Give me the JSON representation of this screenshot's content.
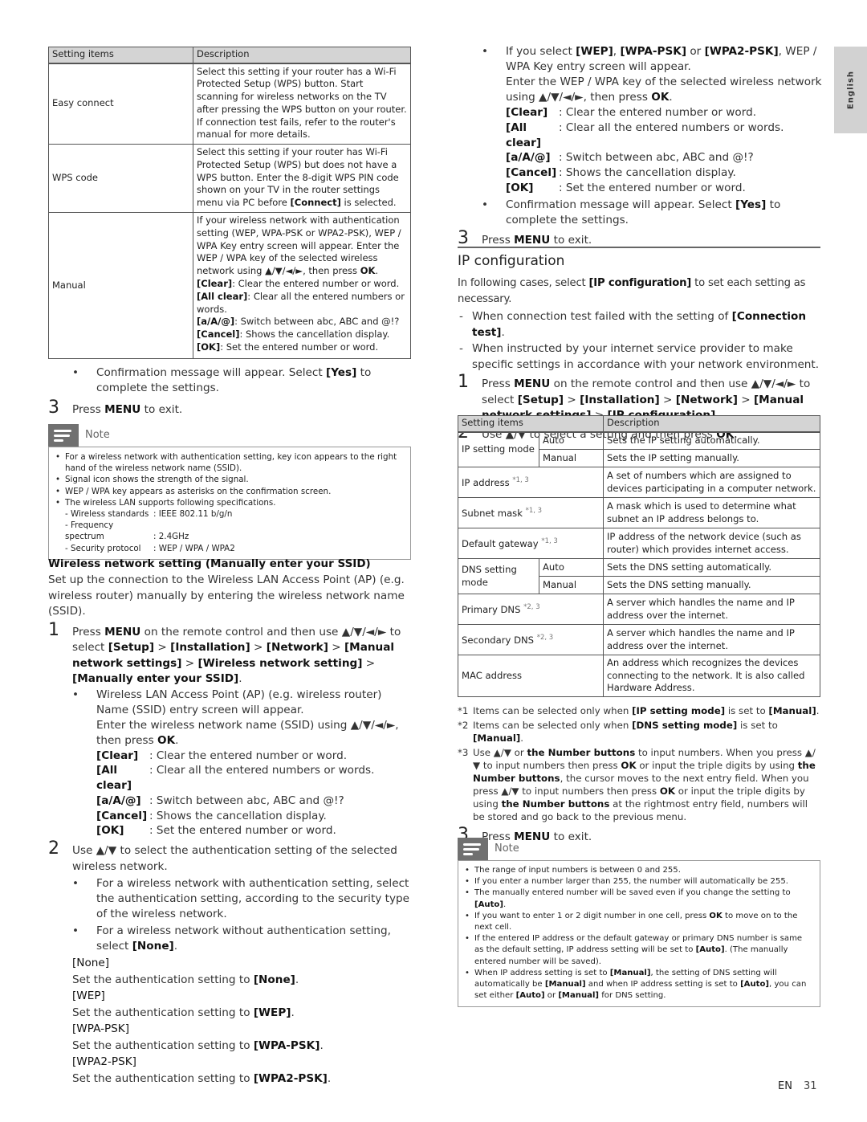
{
  "side_tab": {
    "label": "English"
  },
  "left": {
    "table": {
      "headers": [
        "Setting items",
        "Description"
      ],
      "rows": [
        {
          "item": "Easy connect",
          "desc": "Select this setting if your router has a Wi-Fi Protected Setup (WPS) button. Start scanning for wireless networks on the TV after pressing the WPS button on your router. If connection test fails, refer to the router's manual for more details."
        },
        {
          "item": "WPS code",
          "desc_pre": "Select this setting if your router has Wi-Fi Protected Setup (WPS) but does not have a WPS button. Enter the 8-digit WPS PIN code shown on your TV in the router settings menu via PC before ",
          "desc_bold": "[Connect]",
          "desc_post": " is selected."
        },
        {
          "item": "Manual",
          "desc_intro": "If your wireless network with authentication setting (WEP, WPA-PSK or WPA2-PSK), WEP / WPA Key entry screen will appear. Enter the WEP / WPA key of the selected wireless network using ▲/▼/◄/►, then press ",
          "desc_intro_bold": "OK",
          "keys": [
            {
              "k": "[Clear]",
              "v": ": Clear the entered number or word."
            },
            {
              "k": "[All clear]",
              "v": ": Clear all the entered numbers or words."
            },
            {
              "k": "[a/A/@]",
              "v": ": Switch between abc, ABC and @!?"
            },
            {
              "k": "[Cancel]",
              "v": ": Shows the cancellation display."
            },
            {
              "k": "[OK]",
              "v": ": Set the entered number or word."
            }
          ]
        }
      ]
    },
    "confirm_bullet": {
      "pre": "Confirmation message will appear. Select ",
      "bold": "[Yes]",
      "post": " to complete the settings."
    },
    "step3": {
      "num": "3",
      "pre": "Press ",
      "bold": "MENU",
      "post": " to exit."
    },
    "note": {
      "label": "Note",
      "items": [
        "For a wireless network with authentication setting, key icon appears to the right hand of the wireless network name (SSID).",
        "Signal icon shows the strength of the signal.",
        "WEP / WPA key appears as asterisks on the confirmation screen.",
        "The wireless LAN supports following specifications."
      ],
      "specs": [
        {
          "k": "- Wireless standards",
          "v": ": IEEE 802.11 b/g/n"
        },
        {
          "k": "- Frequency spectrum",
          "v": ": 2.4GHz"
        },
        {
          "k": "- Security protocol",
          "v": ": WEP / WPA / WPA2"
        }
      ]
    },
    "manual_ssid": {
      "heading": "Wireless network setting (Manually enter your SSID)",
      "intro": "Set up the connection to the Wireless LAN Access Point (AP) (e.g. wireless router) manually by entering the wireless network name (SSID).",
      "step1": {
        "num": "1",
        "p1": "Press ",
        "b1": "MENU",
        "p2": " on the remote control and then use ▲/▼/◄/► to select ",
        "b2": "[Setup]",
        "p3": " > ",
        "b3": "[Installation]",
        "p4": " > ",
        "b4": "[Network]",
        "p5": " > ",
        "b5": "[Manual network settings]",
        "p6": " > ",
        "b6": "[Wireless network setting]",
        "p7": " > ",
        "b7": "[Manually enter your SSID]",
        "p8": ".",
        "bullet_a": "Wireless LAN Access Point (AP) (e.g. wireless router) Name (SSID) entry screen will appear.",
        "bullet_b_pre": "Enter the wireless network name (SSID) using ▲/▼/◄/►, then press ",
        "bullet_b_bold": "OK",
        "keys": [
          {
            "k": "[Clear]",
            "v": ": Clear the entered number or word."
          },
          {
            "k": "[All clear]",
            "v": ": Clear all the entered numbers or words."
          },
          {
            "k": "[a/A/@]",
            "v": ": Switch between abc, ABC and @!?"
          },
          {
            "k": "[Cancel]",
            "v": ": Shows the cancellation display."
          },
          {
            "k": "[OK]",
            "v": ": Set the entered number or word."
          }
        ]
      },
      "step2": {
        "num": "2",
        "text": "Use ▲/▼ to select the authentication setting of the selected wireless network.",
        "bullet_a": "For a wireless network with authentication setting, select the authentication setting, according to the security type of the wireless network.",
        "bullet_b_pre": "For a wireless network without authentication setting, select ",
        "bullet_b_bold": "[None]",
        "options": [
          {
            "label": "[None]",
            "desc": "Set the authentication setting to ",
            "value": "[None]"
          },
          {
            "label": "[WEP]",
            "desc": "Set the authentication setting to ",
            "value": "[WEP]"
          },
          {
            "label": "[WPA-PSK]",
            "desc": "Set the authentication setting to ",
            "value": "[WPA-PSK]"
          },
          {
            "label": "[WPA2-PSK]",
            "desc": "Set the authentication setting to ",
            "value": "[WPA2-PSK]"
          }
        ]
      }
    }
  },
  "right": {
    "wep_bullet": {
      "p1": "If you select ",
      "b1": "[WEP]",
      "p2": ", ",
      "b2": "[WPA-PSK]",
      "p3": " or ",
      "b3": "[WPA2-PSK]",
      "p4": ", WEP / WPA Key entry screen will appear.",
      "line2_pre": "Enter the WEP / WPA key of the selected wireless network using ▲/▼/◄/►, then press ",
      "line2_bold": "OK",
      "keys": [
        {
          "k": "[Clear]",
          "v": ": Clear the entered number or word."
        },
        {
          "k": "[All clear]",
          "v": ": Clear all the entered numbers or words."
        },
        {
          "k": "[a/A/@]",
          "v": ": Switch between abc, ABC and @!?"
        },
        {
          "k": "[Cancel]",
          "v": ": Shows the cancellation display."
        },
        {
          "k": "[OK]",
          "v": ": Set the entered number or word."
        }
      ]
    },
    "confirm_bullet": {
      "pre": "Confirmation message will appear. Select ",
      "bold": "[Yes]",
      "post": " to complete the settings."
    },
    "step3": {
      "num": "3",
      "pre": "Press ",
      "bold": "MENU",
      "post": " to exit."
    },
    "ip": {
      "title": "IP configuration",
      "intro_pre": "In following cases, select ",
      "intro_bold": "[IP configuration]",
      "intro_post": " to set each setting as necessary.",
      "dash1_pre": "When connection test failed with the setting of ",
      "dash1_bold": "[Connection test]",
      "dash1_post": ".",
      "dash2": "When instructed by your internet service provider to make specific settings in accordance with your network environment.",
      "step1": {
        "num": "1",
        "p1": "Press ",
        "b1": "MENU",
        "p2": " on the remote control and then use ▲/▼/◄/► to select ",
        "b2": "[Setup]",
        "p3": " > ",
        "b3": "[Installation]",
        "p4": " > ",
        "b4": "[Network]",
        "p5": " > ",
        "b5": "[Manual network settings]",
        "p6": " > ",
        "b6": "[IP configuration]",
        "p7": "."
      },
      "step2": {
        "num": "2",
        "pre": "Use ▲/▼ to select a setting and then press ",
        "bold": "OK",
        "post": "."
      },
      "table": {
        "headers": [
          "Setting items",
          "Description"
        ],
        "rows": {
          "ip_mode": {
            "item": "IP setting mode",
            "auto": "Auto",
            "auto_desc": "Sets the IP setting automatically.",
            "manual": "Manual",
            "manual_desc": "Sets the IP setting manually."
          },
          "ip_address": {
            "item": "IP address",
            "ref": "*1, 3",
            "desc": "A set of numbers which are assigned to devices participating in a computer network."
          },
          "subnet": {
            "item": "Subnet mask",
            "ref": "*1, 3",
            "desc": "A mask which is used to determine what subnet an IP address belongs to."
          },
          "gateway": {
            "item": "Default gateway",
            "ref": "*1, 3",
            "desc": "IP address of the network device (such as router) which provides internet access."
          },
          "dns_mode": {
            "item": "DNS setting mode",
            "auto": "Auto",
            "auto_desc": "Sets the DNS setting automatically.",
            "manual": "Manual",
            "manual_desc": "Sets the DNS setting manually."
          },
          "primary_dns": {
            "item": "Primary DNS",
            "ref": "*2, 3",
            "desc": "A server which handles the name and IP address over the internet."
          },
          "secondary_dns": {
            "item": "Secondary DNS",
            "ref": "*2, 3",
            "desc": "A server which handles the name and IP address over the internet."
          },
          "mac": {
            "item": "MAC address",
            "desc": "An address which recognizes the devices connecting to the network. It is also called Hardware Address."
          }
        }
      },
      "footnotes": {
        "f1": {
          "k": "*1",
          "pre": "Items can be selected only when ",
          "b1": "[IP setting mode]",
          "mid": " is set to ",
          "b2": "[Manual]",
          "post": "."
        },
        "f2": {
          "k": "*2",
          "pre": "Items can be selected only when ",
          "b1": "[DNS setting mode]",
          "mid": " is set to ",
          "b2": "[Manual]",
          "post": "."
        },
        "f3": {
          "k": "*3",
          "s1": "Use ▲/▼ or ",
          "b1": "the Number buttons",
          "s2": " to input numbers. When you press ▲/▼ to input numbers then press ",
          "b2": "OK",
          "s3": " or input the triple digits by using ",
          "b3": "the Number buttons",
          "s4": ", the cursor moves to the next entry field. When you press ▲/▼ to input numbers then press ",
          "b4": "OK",
          "s5": " or input the triple digits by using ",
          "b5": "the Number buttons",
          "s6": " at the rightmost entry field, numbers will be stored and go back to the previous menu."
        }
      },
      "step3": {
        "num": "3",
        "pre": "Press ",
        "bold": "MENU",
        "post": " to exit."
      },
      "note": {
        "label": "Note",
        "n1": "The range of input numbers is between 0 and 255.",
        "n2": "If you enter a number larger than 255, the number will automatically be 255.",
        "n3_pre": "The manually entered number will be saved even if you change the setting to ",
        "n3_bold": "[Auto]",
        "n3_post": ".",
        "n4_pre": "If you want to enter 1 or 2 digit number in one cell, press ",
        "n4_bold": "OK",
        "n4_post": " to move on to the next cell.",
        "n5_pre": "If the entered IP address or the default gateway or primary DNS number is same as the default setting, IP address setting will be set to ",
        "n5_bold": "[Auto]",
        "n5_post": ". (The manually entered number will be saved).",
        "n6_p1": "When IP address setting is set to ",
        "n6_b1": "[Manual]",
        "n6_p2": ", the setting of DNS setting will automatically be ",
        "n6_b2": "[Manual]",
        "n6_p3": " and when IP address setting is set to ",
        "n6_b3": "[Auto]",
        "n6_p4": ", you can set either ",
        "n6_b4": "[Auto]",
        "n6_p5": " or ",
        "n6_b5": "[Manual]",
        "n6_p6": " for DNS setting."
      }
    }
  },
  "footer": {
    "lang": "EN",
    "page": "31"
  }
}
